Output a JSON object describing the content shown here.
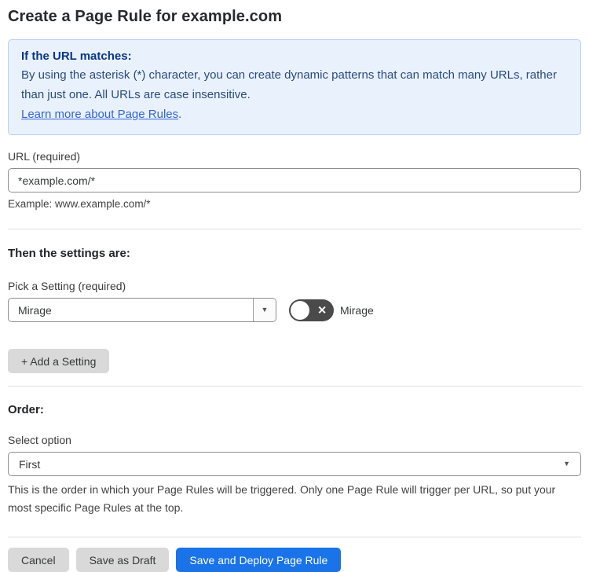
{
  "page": {
    "title": "Create a Page Rule for example.com"
  },
  "info_box": {
    "heading": "If the URL matches:",
    "body": "By using the asterisk (*) character, you can create dynamic patterns that can match many URLs, rather than just one. All URLs are case insensitive.",
    "link_label": "Learn more about Page Rules",
    "link_suffix": "."
  },
  "url_field": {
    "label": "URL (required)",
    "value": "*example.com/*",
    "helper": "Example: www.example.com/*"
  },
  "settings_section": {
    "heading": "Then the settings are:",
    "picker_label": "Pick a Setting (required)",
    "selected_setting": "Mirage",
    "toggle": {
      "label": "Mirage",
      "state": "off",
      "off_icon": "✕"
    },
    "add_setting_label": "+ Add a Setting",
    "dropdown_arrow": "▼"
  },
  "order_section": {
    "heading": "Order:",
    "select_label": "Select option",
    "selected_option": "First",
    "dropdown_arrow": "▼",
    "helper": "This is the order in which your Page Rules will be triggered. Only one Page Rule will trigger per URL, so put your most specific Page Rules at the top."
  },
  "actions": {
    "cancel_label": "Cancel",
    "save_draft_label": "Save as Draft",
    "save_deploy_label": "Save and Deploy Page Rule"
  },
  "colors": {
    "accent_blue": "#1a73e8",
    "info_bg": "#e9f2fc",
    "info_border": "#b3d0ef",
    "info_heading_blue": "#0b3586",
    "info_body_blue": "#2b4a80",
    "link_blue": "#3464d6",
    "toggle_off_bg": "#4a4a4a",
    "gray_button_bg": "#d9d9d9",
    "input_border": "#8d8d8d"
  }
}
